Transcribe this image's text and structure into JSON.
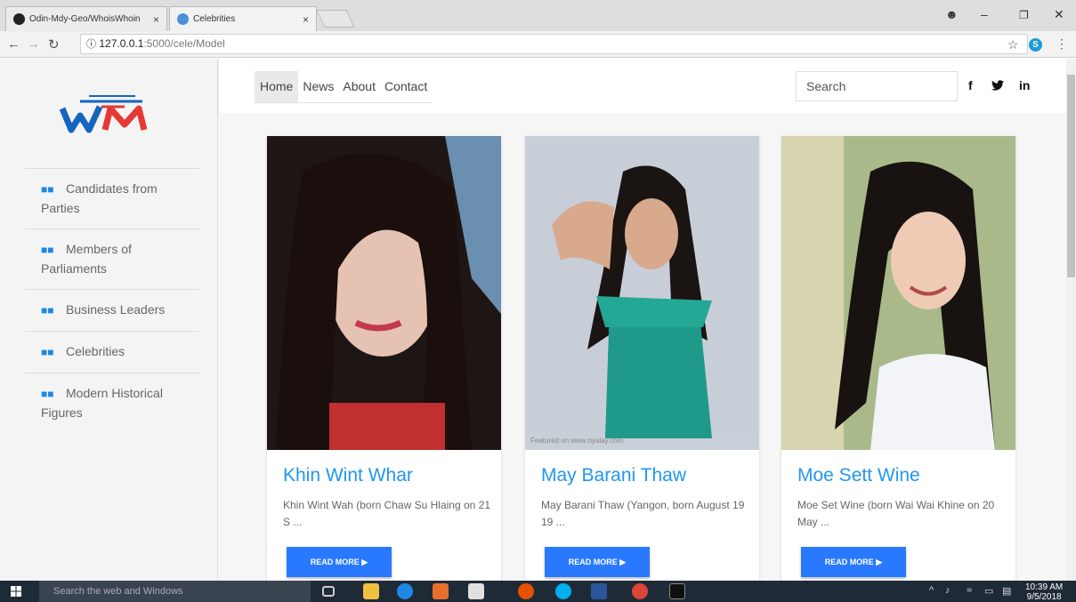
{
  "browser": {
    "tabs": [
      {
        "title": "Odin-Mdy-Geo/WhoisWhoin",
        "close": "×"
      },
      {
        "title": "Celebrities",
        "close": "×"
      }
    ],
    "url_host": "127.0.0.1",
    "url_path": ":5000/cele/Model"
  },
  "nav": {
    "links": [
      "Home",
      "News",
      "About",
      "Contact"
    ],
    "search_placeholder": "Search",
    "social": [
      "f",
      "t",
      "in"
    ]
  },
  "sidebar": {
    "items": [
      {
        "label": "Candidates from Parties"
      },
      {
        "label": "Members of Parliaments"
      },
      {
        "label": "Business Leaders"
      },
      {
        "label": "Celebrities"
      },
      {
        "label": "Modern Historical Figures"
      }
    ]
  },
  "cards": [
    {
      "name": "Khin Wint Whar",
      "desc": "Khin Wint Wah (born Chaw Su Hlaing on 21 S ...",
      "button": "READ MORE"
    },
    {
      "name": "May Barani Thaw",
      "desc": "May Barani Thaw (Yangon, born August 19 19 ...",
      "button": "READ MORE",
      "caption": "Featured on www.nyalay.com"
    },
    {
      "name": "Moe Sett Wine",
      "desc": "Moe Set Wine (born Wai Wai Khine on 20 May ...",
      "button": "READ MORE"
    }
  ],
  "taskbar": {
    "search_placeholder": "Search the web and Windows",
    "time": "10:39 AM",
    "date": "9/5/2018"
  },
  "colors": {
    "accent": "#2196f3",
    "button": "#2979ff",
    "sidebar_icon": "#1e88e5"
  }
}
